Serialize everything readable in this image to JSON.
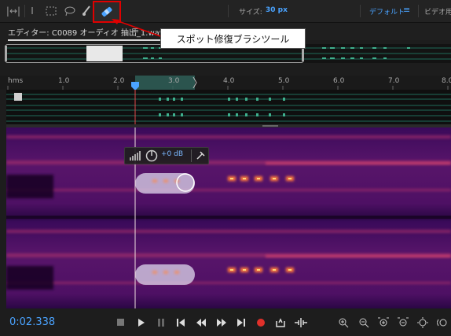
{
  "toolbar": {
    "size_label": "サイズ:",
    "size_value": "30 px",
    "workspace_default": "デフォルト",
    "workspace_menu_icon": "hamburger-icon",
    "workspace_video": "ビデオ用"
  },
  "editor": {
    "tab_title": "エディター: C0089 オーディオ 抽出_1.wav *",
    "tab_menu_icon": "hamburger-icon"
  },
  "callout": {
    "text": "スポット修復ブラシツール"
  },
  "ruler": {
    "unit": "hms",
    "ticks": [
      "1.0",
      "2.0",
      "3.0",
      "4.0",
      "5.0",
      "6.0",
      "7.0",
      "8.0"
    ]
  },
  "hud": {
    "gain": "+0 dB"
  },
  "transport": {
    "timecode": "0:02.338"
  },
  "colors": {
    "accent": "#4aa3ff",
    "highlight": "#e00000",
    "playhead": "#e04a4a"
  }
}
